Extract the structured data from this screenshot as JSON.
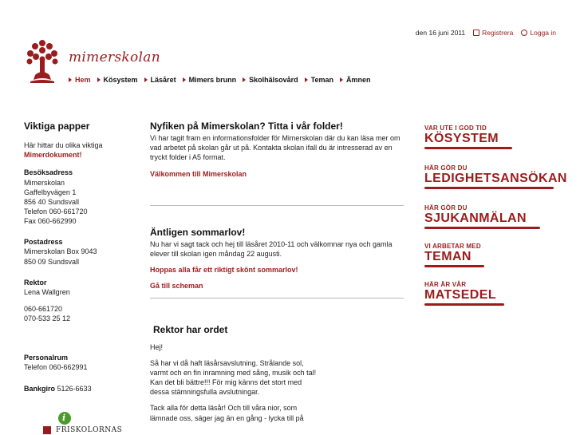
{
  "topbar": {
    "date": "den 16 juni 2011",
    "register": "Registrera",
    "login": "Logga in"
  },
  "brand": {
    "name": "mimerskolan"
  },
  "nav": {
    "items": [
      "Hem",
      "Kösystem",
      "Läsåret",
      "Mimers brunn",
      "Skolhälsovård",
      "Teman",
      "Ämnen"
    ]
  },
  "left": {
    "title": "Viktiga papper",
    "intro": "Här hittar du olika viktiga",
    "intro_link": "Mimerdokument!",
    "visit_title": "Besöksadress",
    "visit_lines": [
      "Mimerskolan",
      "Gaffelbyvägen 1",
      "856 40 Sundsvall",
      "Telefon 060-661720",
      "Fax 060-662990"
    ],
    "post_title": "Postadress",
    "post_lines": [
      "Mimerskolan Box 9043",
      "850 09 Sundsvall"
    ],
    "rektor_title": "Rektor",
    "rektor_name": "Lena Wallgren",
    "rektor_phones": [
      "060-661720",
      "070-533 25 12"
    ],
    "personal_title": "Personalrum",
    "personal_phone": "Telefon 060-662991",
    "bankgiro_label": "Bankgiro",
    "bankgiro_value": "5126-6633",
    "footer_logo_text": "FRISKOLORNAS"
  },
  "center": {
    "article1": {
      "title": "Nyfiken på Mimerskolan? Titta i vår folder!",
      "body": "Vi har tagit fram en informationsfolder för Mimerskolan där du kan läsa mer om vad arbetet på skolan går ut på. Kontakta skolan ifall du är intresserad av en tryckt folder i A5 format.",
      "link": "Välkommen till Mimerskolan"
    },
    "article2": {
      "title": "Äntligen sommarlov!",
      "body": "Nu har vi sagt tack och hej till läsåret 2010-11 och välkomnar nya och gamla elever till skolan igen måndag 22 augusti.",
      "link1": "Hoppas alla får ett riktigt skönt sommarlov!",
      "link2": "Gå till scheman"
    },
    "article3": {
      "title": "Rektor har ordet",
      "greeting": "Hej!",
      "p1": "Så har vi då haft läsårsavslutning. Strålande sol, varmt och en fin inramning med sång, musik och tal! Kan det bli bättre!!! För mig känns det stort med dessa stämningsfulla avslutningar.",
      "p2": "Tack alla för detta läsår! Och till våra nior, som lämnade oss, säger jag än en gång - lycka till på"
    }
  },
  "banners": [
    {
      "small": "VAR UTE I GOD TID",
      "big": "KÖSYSTEM"
    },
    {
      "small": "HÄR GÖR DU",
      "big": "LEDIGHETSANSÖKAN"
    },
    {
      "small": "HÄR GÖR DU",
      "big": "SJUKANMÄLAN"
    },
    {
      "small": "VI ARBETAR MED",
      "big": "TEMAN"
    },
    {
      "small": "HÄR ÄR VÅR",
      "big": "MATSEDEL"
    }
  ],
  "colors": {
    "accent": "#9b1c1c",
    "separator": "#bbbbbb"
  }
}
